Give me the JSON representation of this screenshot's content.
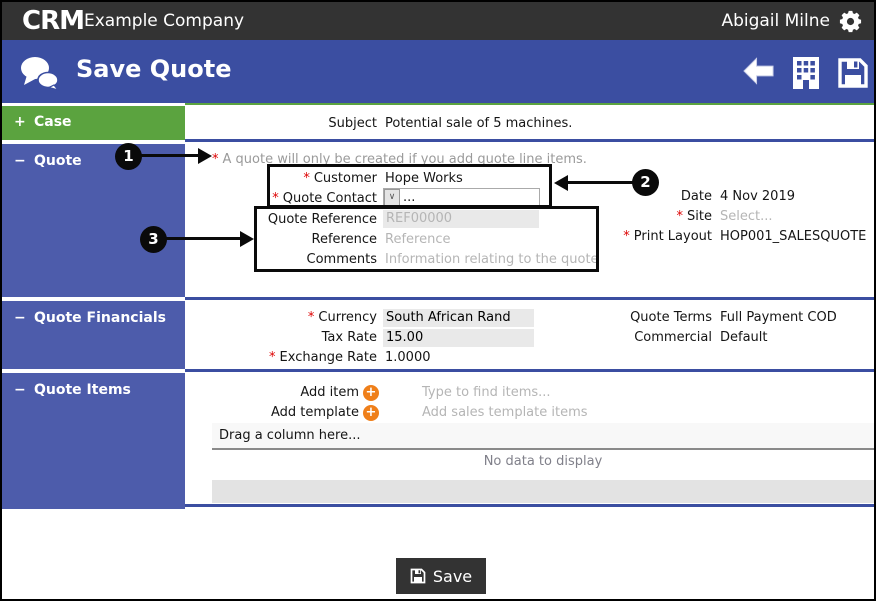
{
  "required_marker": "*",
  "topbar": {
    "logo": "CRM",
    "company": "Example Company",
    "user": "Abigail Milne"
  },
  "titlebar": {
    "title": "Save Quote"
  },
  "sidebar": {
    "sections": [
      {
        "prefix": "+",
        "label": "Case"
      },
      {
        "prefix": "−",
        "label": "Quote"
      },
      {
        "prefix": "−",
        "label": "Quote Financials"
      },
      {
        "prefix": "−",
        "label": "Quote Items"
      }
    ]
  },
  "case_section": {
    "subject_label": "Subject",
    "subject_value": "Potential sale of 5 machines."
  },
  "quote_section": {
    "warning": "A quote will only be created if you add quote line items.",
    "customer_label": "Customer",
    "customer_value": "Hope Works",
    "quote_contact_label": "Quote Contact",
    "quote_contact_value": "...",
    "quote_reference_label": "Quote Reference",
    "quote_reference_value": "REF00000",
    "reference_label": "Reference",
    "reference_placeholder": "Reference",
    "comments_label": "Comments",
    "comments_placeholder": "Information relating to the quote",
    "date_label": "Date",
    "date_value": "4 Nov 2019",
    "site_label": "Site",
    "site_placeholder": "Select...",
    "print_layout_label": "Print Layout",
    "print_layout_value": "HOP001_SALESQUOTE"
  },
  "financials_section": {
    "currency_label": "Currency",
    "currency_value": "South African Rand",
    "tax_rate_label": "Tax Rate",
    "tax_rate_value": "15.00",
    "exchange_rate_label": "Exchange Rate",
    "exchange_rate_value": "1.0000",
    "quote_terms_label": "Quote Terms",
    "quote_terms_value": "Full Payment COD",
    "commercial_label": "Commercial",
    "commercial_value": "Default"
  },
  "items_section": {
    "add_item_label": "Add item",
    "add_item_placeholder": "Type to find items...",
    "add_template_label": "Add template",
    "add_template_placeholder": "Add sales template items",
    "grid_group_hint": "Drag a column here...",
    "grid_empty": "No data to display"
  },
  "callouts": [
    {
      "n": "1"
    },
    {
      "n": "2"
    },
    {
      "n": "3"
    }
  ],
  "save_button": {
    "label": "Save"
  },
  "colors": {
    "topbar": "#333333",
    "accent_blue": "#3B4EA1",
    "sidebar_blue": "#4D5CAB",
    "case_green": "#5BA33F",
    "add_orange": "#EF7F1A",
    "required_red": "#DD0000"
  }
}
